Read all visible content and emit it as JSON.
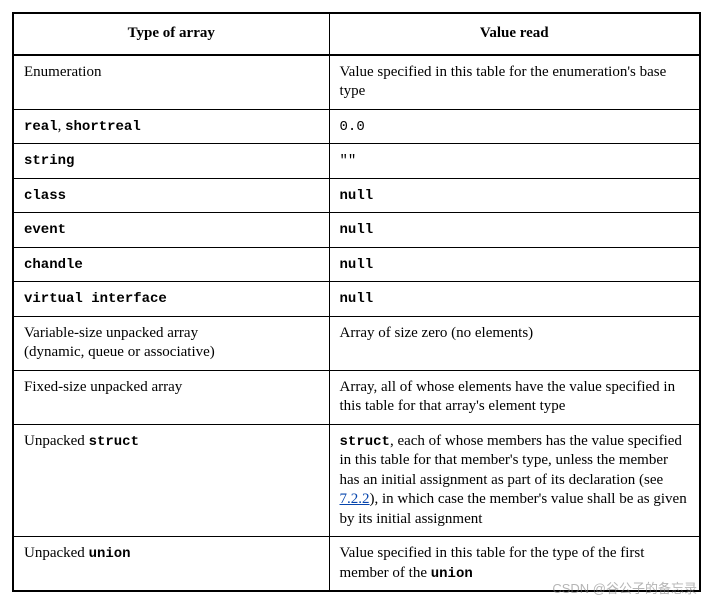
{
  "headers": {
    "col1": "Type of array",
    "col2": "Value read"
  },
  "rows": {
    "enum": {
      "label": "Enumeration",
      "value": "Value specified in this table for the enumeration's base type"
    },
    "real": {
      "kw1": "real",
      "sep": ", ",
      "kw2": "shortreal",
      "value": "0.0"
    },
    "string": {
      "kw": "string",
      "value": "\"\""
    },
    "class": {
      "kw": "class",
      "value": "null"
    },
    "event": {
      "kw": "event",
      "value": "null"
    },
    "chandle": {
      "kw": "chandle",
      "value": "null"
    },
    "vintf": {
      "kw": "virtual interface",
      "value": "null"
    },
    "varsize": {
      "line1": "Variable-size unpacked array",
      "line2": "(dynamic, queue or associative)",
      "value": "Array of size zero (no elements)"
    },
    "fixedsize": {
      "label": "Fixed-size unpacked array",
      "value": "Array, all of whose elements have the value specified in this table for that array's element type"
    },
    "struct": {
      "pre": "Unpacked ",
      "kw": "struct",
      "v_kw": "struct",
      "v1": ", each of whose members has the value specified in this table for that member's type, unless the member has an initial assignment as part of its declaration (see ",
      "link": "7.2.2",
      "v2": "), in which case the member's value shall be as given by its initial assignment"
    },
    "union": {
      "pre": "Unpacked ",
      "kw": "union",
      "v1": "Value specified in this table for the type of the first member of the ",
      "v_kw": "union"
    }
  },
  "watermark": "CSDN @谷公子的备忘录"
}
